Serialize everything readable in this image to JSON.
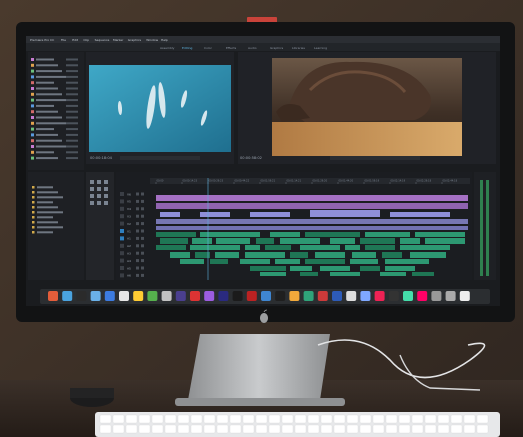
{
  "scene": {
    "description_icons": {
      "apple_logo": "apple-logo-icon",
      "keyboard": "keyboard",
      "cable": "usb-cable"
    }
  },
  "editor": {
    "menu": [
      "Premiere Pro CC",
      "File",
      "Edit",
      "Clip",
      "Sequence",
      "Marker",
      "Graphics",
      "Window",
      "Help"
    ],
    "workspace_tabs": [
      "Assembly",
      "Editing",
      "Color",
      "Effects",
      "Audio",
      "Graphics",
      "Libraries",
      "Learning"
    ],
    "source_timecode": "00:00:18:04",
    "program_timecode": "00:00:58:02",
    "timeline_ruler": [
      "00:00",
      "00:00:14:23",
      "00:00:29:23",
      "00:00:44:22",
      "00:01:59:21",
      "00:01:14:21",
      "00:01:29:20",
      "00:01:44:20",
      "00:01:59:19",
      "00:02:14:19",
      "00:02:29:18",
      "00:02:44:18"
    ],
    "track_labels": [
      "V6",
      "V5",
      "V4",
      "V3",
      "V2",
      "V1",
      "A1",
      "A2",
      "A3",
      "A4",
      "A5",
      "A6"
    ]
  },
  "colors": {
    "wall": "#3a2f27",
    "bezel": "#141516",
    "panel_bg": "#1d1f22",
    "video_clip": "#b57bd6",
    "video_clip_alt": "#8f8fd8",
    "audio_clip": "#2fa37a",
    "audio_clip_dark": "#1f7e5a",
    "underwater": "#2d8fb2",
    "turtle_sky": "#5a4a3c",
    "sand": "#c89a5c",
    "monitor_silver": "#b7b9bb",
    "keyboard": "#e7e8ea"
  }
}
